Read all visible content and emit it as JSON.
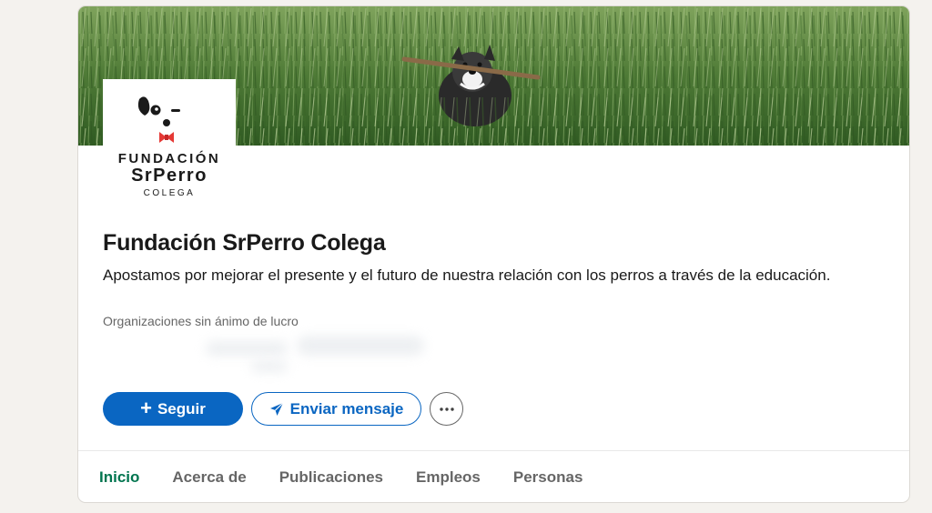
{
  "organization": {
    "name": "Fundación SrPerro Colega",
    "tagline": "Apostamos por mejorar el presente y el futuro de nuestra relación con los perros a través de la educación.",
    "industry": "Organizaciones sin ánimo de lucro"
  },
  "logo": {
    "line1": "FUNDACIÓN",
    "line2": "SrPerro",
    "line3": "COLEGA",
    "bow_color": "#e53935"
  },
  "cover": {
    "description_icon": "dog-in-wheat-field-photo"
  },
  "actions": {
    "follow_label": "Seguir",
    "follow_icon": "plus-icon",
    "message_label": "Enviar mensaje",
    "message_icon": "paper-plane-icon",
    "more_icon": "ellipsis-icon"
  },
  "tabs": [
    {
      "label": "Inicio",
      "active": true
    },
    {
      "label": "Acerca de",
      "active": false
    },
    {
      "label": "Publicaciones",
      "active": false
    },
    {
      "label": "Empleos",
      "active": false
    },
    {
      "label": "Personas",
      "active": false
    }
  ],
  "colors": {
    "accent_blue": "#0a66c2",
    "active_tab_green": "#01754f",
    "background": "#f4f2ee"
  }
}
